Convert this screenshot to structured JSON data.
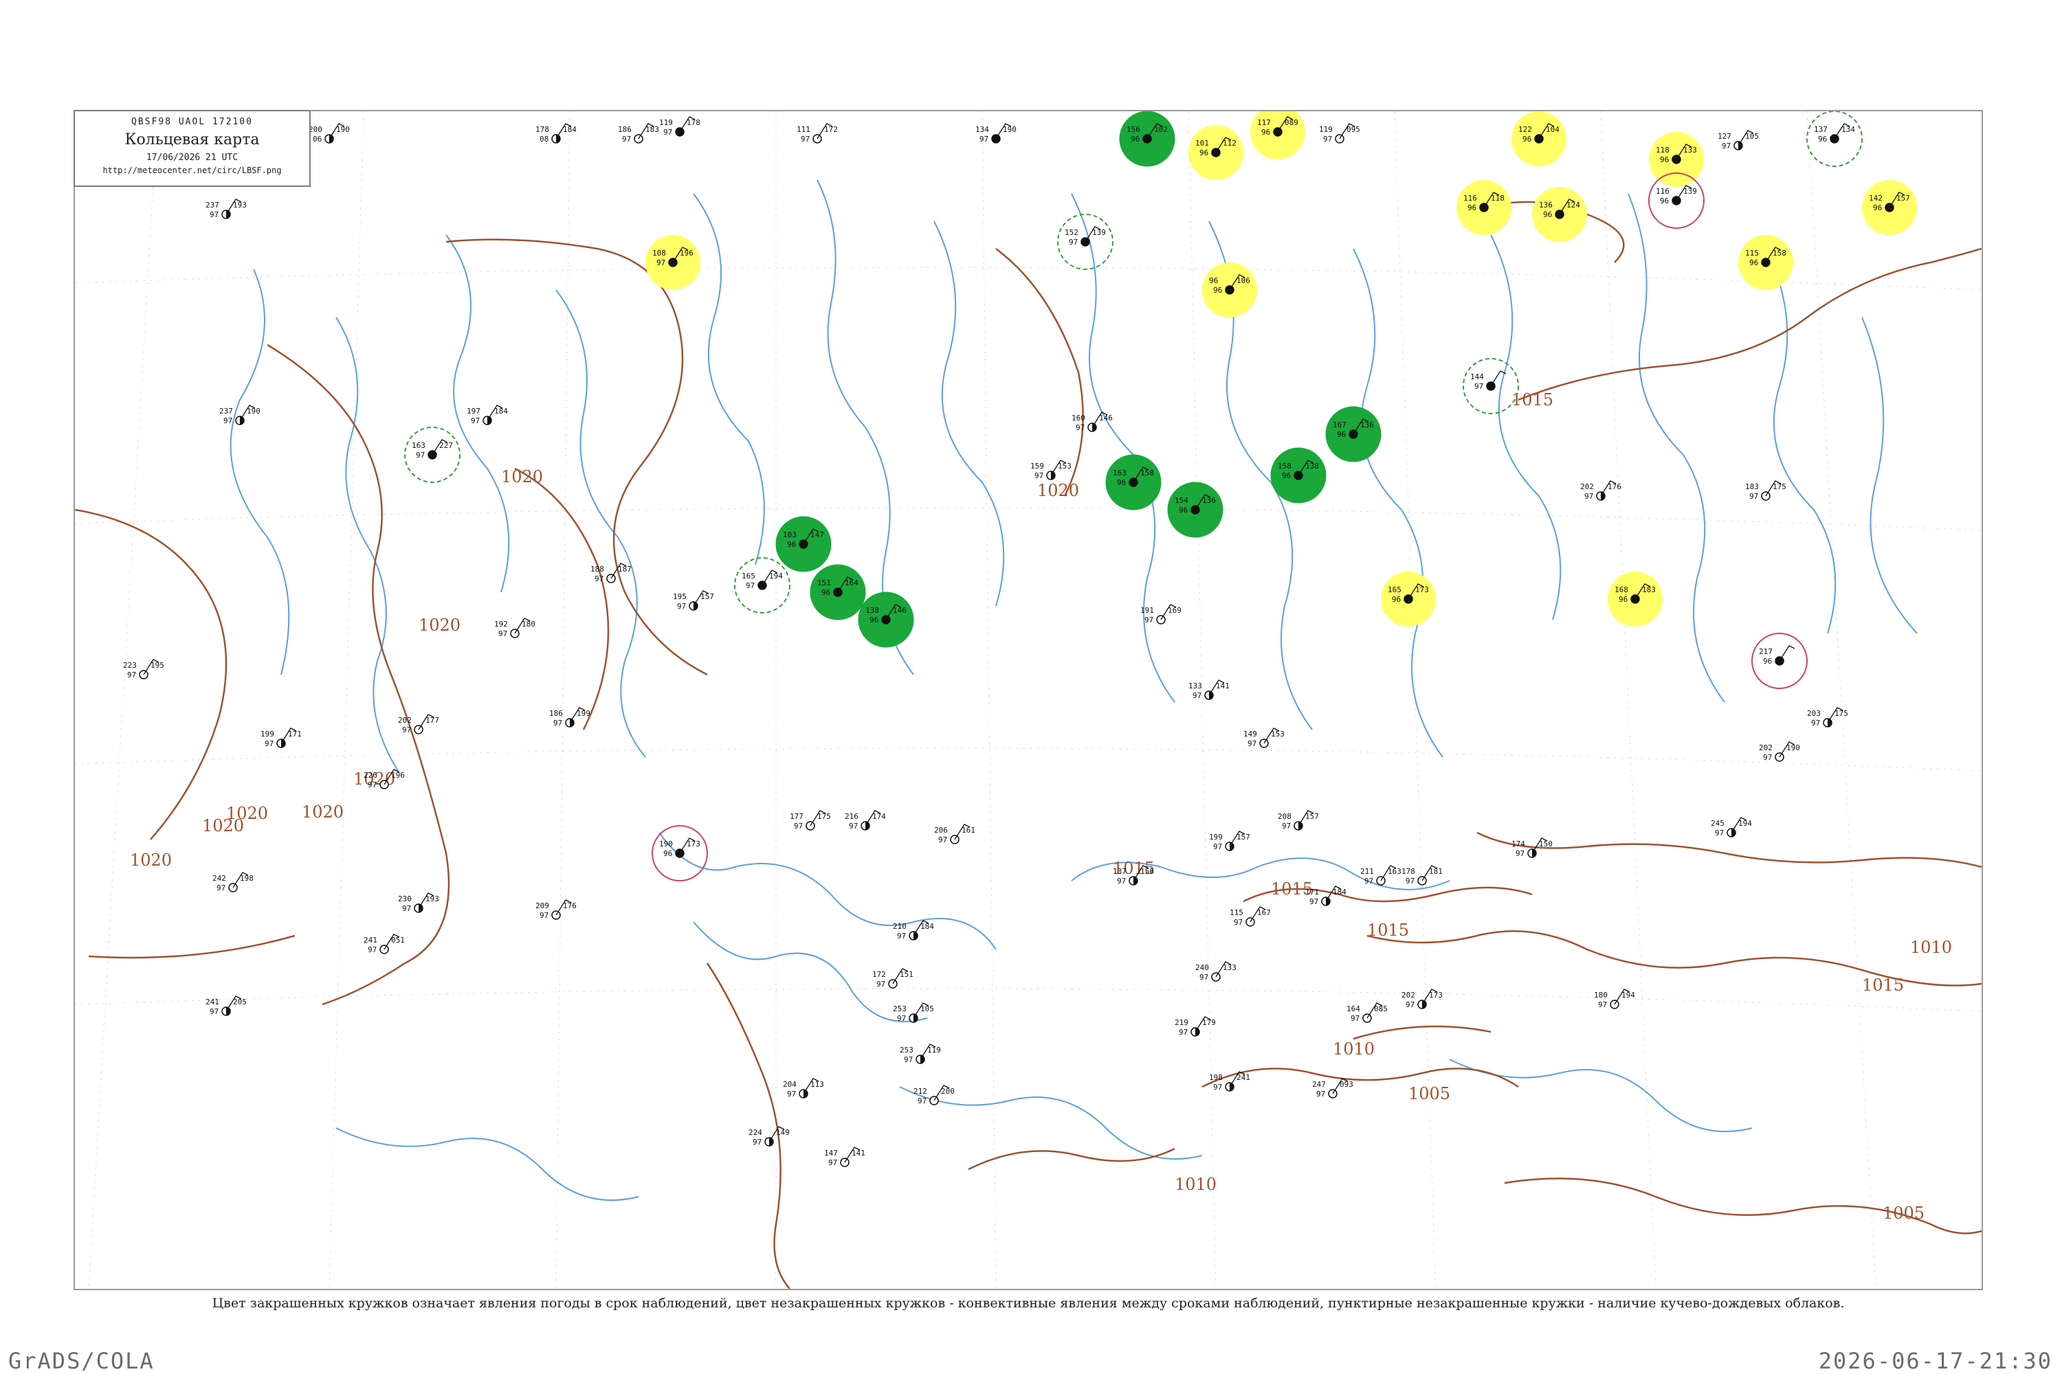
{
  "legend": {
    "code": "QBSF98  UAOL  172100",
    "title": "Кольцевая карта",
    "time": "17/06/2026 21 UTC",
    "url": "http://meteocenter.net/circ/LBSF.png"
  },
  "caption": "Цвет закрашенных кружков означает явления погоды в срок наблюдений, цвет незакрашенных кружков - конвективные явления между сроками наблюдений, пунктирные незакрашенные кружки - наличие кучево-дождевых облаков.",
  "footer": {
    "left": "GrADS/COLA",
    "right": "2026-06-17-21:30"
  },
  "colors": {
    "isobar": "#a0522d",
    "water": "#5aa0e0",
    "rain": "#1aa83a",
    "fog": "#ffff66",
    "thunder_ring": "#d04070",
    "convective_ring": "#30a040"
  },
  "isobar_labels": [
    {
      "value": "1020"
    },
    {
      "value": "1020"
    },
    {
      "value": "1020"
    },
    {
      "value": "1020"
    },
    {
      "value": "1020"
    },
    {
      "value": "1020"
    },
    {
      "value": "1020"
    },
    {
      "value": "1020"
    },
    {
      "value": "1015"
    },
    {
      "value": "1015"
    },
    {
      "value": "1015"
    },
    {
      "value": "1015"
    },
    {
      "value": "1015"
    },
    {
      "value": "1010"
    },
    {
      "value": "1010"
    },
    {
      "value": "1010"
    },
    {
      "value": "1005"
    },
    {
      "value": "1005"
    }
  ],
  "stations": [
    {
      "id": "s1",
      "t": "200",
      "p": "190",
      "m": "06",
      "w": "s",
      "circle": ""
    },
    {
      "id": "s2",
      "t": "178",
      "p": "184",
      "m": "08",
      "w": "s",
      "circle": ""
    },
    {
      "id": "s3",
      "t": "186",
      "p": "183",
      "m": "97",
      "w": "o",
      "circle": ""
    },
    {
      "id": "s4",
      "t": "119",
      "p": "178",
      "m": "97",
      "w": "f",
      "circle": ""
    },
    {
      "id": "s5",
      "t": "111",
      "p": "172",
      "m": "97",
      "w": "o",
      "circle": ""
    },
    {
      "id": "s6",
      "t": "134",
      "p": "190",
      "m": "97",
      "w": "f",
      "circle": ""
    },
    {
      "id": "s7",
      "t": "156",
      "p": "102",
      "m": "96",
      "w": "f",
      "circle": "rain"
    },
    {
      "id": "s8",
      "t": "101",
      "p": "112",
      "m": "96",
      "w": "f",
      "circle": "fog"
    },
    {
      "id": "s9",
      "t": "117",
      "p": "089",
      "m": "96",
      "w": "f",
      "circle": "fog"
    },
    {
      "id": "s10",
      "t": "119",
      "p": "095",
      "m": "97",
      "w": "o",
      "circle": ""
    },
    {
      "id": "s11",
      "t": "122",
      "p": "104",
      "m": "96",
      "w": "f",
      "circle": "fog"
    },
    {
      "id": "s12",
      "t": "127",
      "p": "105",
      "m": "97",
      "w": "s",
      "circle": ""
    },
    {
      "id": "s13",
      "t": "137",
      "p": "134",
      "m": "96",
      "w": "f",
      "circle": "conv"
    },
    {
      "id": "s14",
      "t": "118",
      "p": "133",
      "m": "96",
      "w": "f",
      "circle": "fog"
    },
    {
      "id": "s15",
      "t": "116",
      "p": "139",
      "m": "96",
      "w": "f",
      "circle": "thunder"
    },
    {
      "id": "s16",
      "t": "142",
      "p": "157",
      "m": "96",
      "w": "f",
      "circle": "fog"
    },
    {
      "id": "s17",
      "t": "115",
      "p": "158",
      "m": "96",
      "w": "f",
      "circle": "fog"
    },
    {
      "id": "s18",
      "t": "108",
      "p": "196",
      "m": "97",
      "w": "f",
      "circle": "fog"
    },
    {
      "id": "s19",
      "t": "96",
      "p": "106",
      "m": "96",
      "w": "f",
      "circle": "fog"
    },
    {
      "id": "s20",
      "t": "136",
      "p": "124",
      "m": "96",
      "w": "f",
      "circle": "fog"
    },
    {
      "id": "s21",
      "t": "116",
      "p": "118",
      "m": "96",
      "w": "f",
      "circle": "fog"
    },
    {
      "id": "s22",
      "t": "163",
      "p": "227",
      "m": "97",
      "w": "f",
      "circle": "conv"
    },
    {
      "id": "s23",
      "t": "165",
      "p": "194",
      "m": "97",
      "w": "f",
      "circle": "conv"
    },
    {
      "id": "s24",
      "t": "151",
      "p": "164",
      "m": "96",
      "w": "f",
      "circle": "rain"
    },
    {
      "id": "s25",
      "t": "138",
      "p": "146",
      "m": "96",
      "w": "f",
      "circle": "rain"
    },
    {
      "id": "s26",
      "t": "103",
      "p": "147",
      "m": "96",
      "w": "f",
      "circle": "rain"
    },
    {
      "id": "s27",
      "t": "163",
      "p": "158",
      "m": "96",
      "w": "f",
      "circle": "rain"
    },
    {
      "id": "s28",
      "t": "154",
      "p": "136",
      "m": "96",
      "w": "f",
      "circle": "rain"
    },
    {
      "id": "s29",
      "t": "158",
      "p": "138",
      "m": "96",
      "w": "f",
      "circle": "rain"
    },
    {
      "id": "s30",
      "t": "167",
      "p": "136",
      "m": "96",
      "w": "f",
      "circle": "rain"
    },
    {
      "id": "s31",
      "t": "165",
      "p": "173",
      "m": "96",
      "w": "f",
      "circle": "fog"
    },
    {
      "id": "s32",
      "t": "168",
      "p": "183",
      "m": "96",
      "w": "f",
      "circle": "fog"
    },
    {
      "id": "s33",
      "t": "217",
      "p": "",
      "m": "96",
      "w": "f",
      "circle": "thunder"
    },
    {
      "id": "s34",
      "t": "190",
      "p": "173",
      "m": "96",
      "w": "f",
      "circle": "thunder"
    },
    {
      "id": "s35",
      "t": "144",
      "p": "",
      "m": "97",
      "w": "f",
      "circle": "conv"
    },
    {
      "id": "s36",
      "t": "152",
      "p": "139",
      "m": "97",
      "w": "f",
      "circle": "conv"
    },
    {
      "id": "s37",
      "t": "160",
      "p": "146",
      "m": "97",
      "w": "s",
      "circle": ""
    },
    {
      "id": "s38",
      "t": "159",
      "p": "153",
      "m": "97",
      "w": "s",
      "circle": ""
    },
    {
      "id": "s39",
      "t": "188",
      "p": "187",
      "m": "97",
      "w": "o",
      "circle": ""
    },
    {
      "id": "s40",
      "t": "197",
      "p": "184",
      "m": "97",
      "w": "s",
      "circle": ""
    },
    {
      "id": "s41",
      "t": "226",
      "p": "196",
      "m": "97",
      "w": "o",
      "circle": ""
    },
    {
      "id": "s42",
      "t": "230",
      "p": "193",
      "m": "97",
      "w": "s",
      "circle": ""
    },
    {
      "id": "s43",
      "t": "209",
      "p": "176",
      "m": "97",
      "w": "o",
      "circle": ""
    },
    {
      "id": "s44",
      "t": "186",
      "p": "199",
      "m": "97",
      "w": "s",
      "circle": ""
    },
    {
      "id": "s45",
      "t": "192",
      "p": "180",
      "m": "97",
      "w": "o",
      "circle": ""
    },
    {
      "id": "s46",
      "t": "195",
      "p": "157",
      "m": "97",
      "w": "s",
      "circle": ""
    },
    {
      "id": "s47",
      "t": "177",
      "p": "175",
      "m": "97",
      "w": "o",
      "circle": ""
    },
    {
      "id": "s48",
      "t": "216",
      "p": "174",
      "m": "97",
      "w": "s",
      "circle": ""
    },
    {
      "id": "s49",
      "t": "206",
      "p": "161",
      "m": "97",
      "w": "o",
      "circle": ""
    },
    {
      "id": "s50",
      "t": "199",
      "p": "157",
      "m": "97",
      "w": "s",
      "circle": ""
    },
    {
      "id": "s51",
      "t": "208",
      "p": "157",
      "m": "97",
      "w": "s",
      "circle": ""
    },
    {
      "id": "s52",
      "t": "211",
      "p": "163",
      "m": "97",
      "w": "o",
      "circle": ""
    },
    {
      "id": "s53",
      "t": "210",
      "p": "184",
      "m": "97",
      "w": "s",
      "circle": ""
    },
    {
      "id": "s54",
      "t": "172",
      "p": "151",
      "m": "97",
      "w": "o",
      "circle": ""
    },
    {
      "id": "s55",
      "t": "137",
      "p": "156",
      "m": "97",
      "w": "s",
      "circle": ""
    },
    {
      "id": "s56",
      "t": "115",
      "p": "167",
      "m": "97",
      "w": "o",
      "circle": ""
    },
    {
      "id": "s57",
      "t": "171",
      "p": "184",
      "m": "97",
      "w": "s",
      "circle": ""
    },
    {
      "id": "s58",
      "t": "178",
      "p": "181",
      "m": "97",
      "w": "o",
      "circle": ""
    },
    {
      "id": "s59",
      "t": "174",
      "p": "150",
      "m": "97",
      "w": "s",
      "circle": ""
    },
    {
      "id": "s60",
      "t": "241",
      "p": "051",
      "m": "97",
      "w": "o",
      "circle": ""
    },
    {
      "id": "s61",
      "t": "253",
      "p": "105",
      "m": "97",
      "w": "s",
      "circle": ""
    },
    {
      "id": "s62",
      "t": "223",
      "p": "195",
      "m": "97",
      "w": "o",
      "circle": ""
    },
    {
      "id": "s63",
      "t": "237",
      "p": "190",
      "m": "97",
      "w": "s",
      "circle": ""
    },
    {
      "id": "s64",
      "t": "242",
      "p": "198",
      "m": "97",
      "w": "o",
      "circle": ""
    },
    {
      "id": "s65",
      "t": "241",
      "p": "205",
      "m": "97",
      "w": "s",
      "circle": ""
    },
    {
      "id": "s66",
      "t": "215",
      "p": "195",
      "m": "97",
      "w": "o",
      "circle": ""
    },
    {
      "id": "s67",
      "t": "237",
      "p": "193",
      "m": "97",
      "w": "s",
      "circle": ""
    },
    {
      "id": "s68",
      "t": "202",
      "p": "177",
      "m": "97",
      "w": "o",
      "circle": ""
    },
    {
      "id": "s69",
      "t": "199",
      "p": "171",
      "m": "97",
      "w": "s",
      "circle": ""
    },
    {
      "id": "s70",
      "t": "240",
      "p": "133",
      "m": "97",
      "w": "o",
      "circle": ""
    },
    {
      "id": "s71",
      "t": "253",
      "p": "119",
      "m": "97",
      "w": "s",
      "circle": ""
    },
    {
      "id": "s72",
      "t": "212",
      "p": "200",
      "m": "97",
      "w": "o",
      "circle": ""
    },
    {
      "id": "s73",
      "t": "224",
      "p": "149",
      "m": "97",
      "w": "s",
      "circle": ""
    },
    {
      "id": "s74",
      "t": "147",
      "p": "141",
      "m": "97",
      "w": "o",
      "circle": ""
    },
    {
      "id": "s75",
      "t": "198",
      "p": "241",
      "m": "97",
      "w": "s",
      "circle": ""
    },
    {
      "id": "s76",
      "t": "247",
      "p": "093",
      "m": "97",
      "w": "o",
      "circle": ""
    },
    {
      "id": "s77",
      "t": "204",
      "p": "113",
      "m": "97",
      "w": "s",
      "circle": ""
    },
    {
      "id": "s78",
      "t": "164",
      "p": "085",
      "m": "97",
      "w": "o",
      "circle": ""
    },
    {
      "id": "s79",
      "t": "202",
      "p": "173",
      "m": "97",
      "w": "s",
      "circle": ""
    },
    {
      "id": "s80",
      "t": "180",
      "p": "194",
      "m": "97",
      "w": "o",
      "circle": ""
    },
    {
      "id": "s81",
      "t": "245",
      "p": "194",
      "m": "97",
      "w": "s",
      "circle": ""
    },
    {
      "id": "s82",
      "t": "202",
      "p": "190",
      "m": "97",
      "w": "o",
      "circle": ""
    },
    {
      "id": "s83",
      "t": "203",
      "p": "175",
      "m": "97",
      "w": "s",
      "circle": ""
    },
    {
      "id": "s84",
      "t": "149",
      "p": "153",
      "m": "97",
      "w": "o",
      "circle": ""
    },
    {
      "id": "s85",
      "t": "133",
      "p": "141",
      "m": "97",
      "w": "s",
      "circle": ""
    },
    {
      "id": "s86",
      "t": "191",
      "p": "169",
      "m": "97",
      "w": "o",
      "circle": ""
    },
    {
      "id": "s87",
      "t": "202",
      "p": "176",
      "m": "97",
      "w": "s",
      "circle": ""
    },
    {
      "id": "s88",
      "t": "183",
      "p": "175",
      "m": "97",
      "w": "o",
      "circle": ""
    },
    {
      "id": "s89",
      "t": "219",
      "p": "179",
      "m": "97",
      "w": "s",
      "circle": ""
    }
  ]
}
